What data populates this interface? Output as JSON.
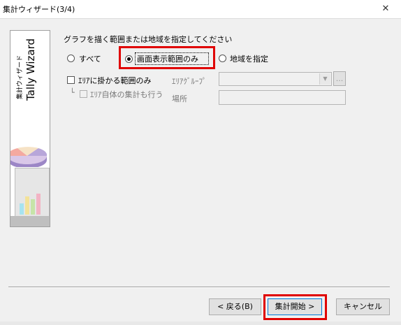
{
  "window": {
    "title": "集計ウィザード(3/4)",
    "close_glyph": "✕"
  },
  "side": {
    "title_en": "Tally Wizard",
    "title_jp": "集計ウィザード"
  },
  "prompt": "グラフを描く範囲または地域を指定してください",
  "range_options": [
    {
      "label": "すべて",
      "checked": false
    },
    {
      "label": "画面表示範囲のみ",
      "checked": true
    },
    {
      "label": "地域を指定",
      "checked": false
    }
  ],
  "area_checkbox": {
    "label": "ｴﾘｱに掛かる範囲のみ",
    "checked": false
  },
  "area_self_checkbox": {
    "prefix": "└",
    "label": "ｴﾘｱ自体の集計も行う",
    "checked": false
  },
  "area_group": {
    "label": "ｴﾘｱｸﾞﾙｰﾌﾟ",
    "value": "",
    "browse_label": "..."
  },
  "location": {
    "label": "場所",
    "value": ""
  },
  "buttons": {
    "back": "< 戻る(B)",
    "start": "集計開始 >",
    "cancel": "キャンセル"
  },
  "colors": {
    "highlight": "#e00000"
  }
}
